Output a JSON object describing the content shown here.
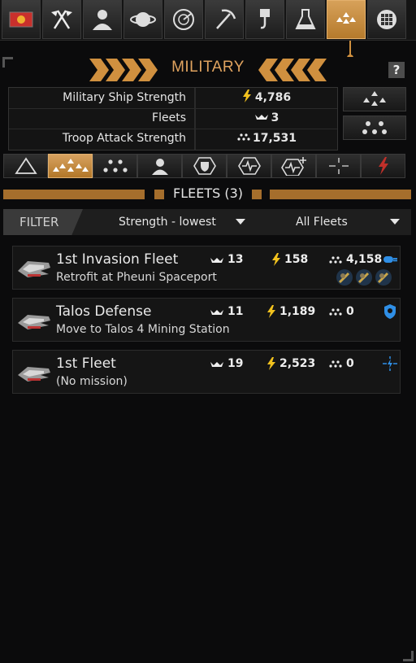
{
  "topbar": {
    "buttons": [
      {
        "icon": "empire-flag-icon",
        "active": false
      },
      {
        "icon": "diplomacy-flags-icon",
        "active": false
      },
      {
        "icon": "leader-person-icon",
        "active": false
      },
      {
        "icon": "planet-icon",
        "active": false
      },
      {
        "icon": "radar-icon",
        "active": false
      },
      {
        "icon": "mining-pickaxe-icon",
        "active": false
      },
      {
        "icon": "construction-hook-icon",
        "active": false
      },
      {
        "icon": "research-flask-icon",
        "active": false
      },
      {
        "icon": "military-fleet-icon",
        "active": true
      },
      {
        "icon": "colonies-grid-icon",
        "active": false
      }
    ]
  },
  "header": {
    "title": "MILITARY",
    "help_label": "?"
  },
  "stats": {
    "rows": [
      {
        "label": "Military Ship Strength",
        "value": "4,786",
        "icon": "lightning-icon"
      },
      {
        "label": "Fleets",
        "value": "3",
        "icon": "ships-icon"
      },
      {
        "label": "Troop Attack Strength",
        "value": "17,531",
        "icon": "troops-icon"
      }
    ]
  },
  "tabs": [
    {
      "icon": "triangle-outline-icon",
      "active": false
    },
    {
      "icon": "fleets-tab-icon",
      "active": true
    },
    {
      "icon": "troops-dots-icon",
      "active": false
    },
    {
      "icon": "person-icon",
      "active": false
    },
    {
      "icon": "shield-hex-icon",
      "active": false
    },
    {
      "icon": "pulse-hex-icon",
      "active": false
    },
    {
      "icon": "pulse-plus-icon",
      "active": false
    },
    {
      "icon": "crosshair-icon",
      "active": false
    },
    {
      "icon": "lightning-red-icon",
      "active": false
    }
  ],
  "fleets_header": {
    "title": "FLEETS (3)"
  },
  "filter": {
    "label": "FILTER",
    "sort_value": "Strength - lowest",
    "fleet_filter_value": "All Fleets"
  },
  "fleets": [
    {
      "name": "1st Invasion Fleet",
      "mission": "Retrofit at Pheuni Spaceport",
      "ships": "13",
      "strength": "158",
      "troops": "4,158",
      "status": "retrofit-icon",
      "status_color": "#2f8fe6",
      "has_troops": true
    },
    {
      "name": "Talos Defense",
      "mission": "Move to Talos 4 Mining Station",
      "ships": "11",
      "strength": "1,189",
      "troops": "0",
      "status": "location-pin-icon",
      "status_color": "#2f8fe6",
      "has_troops": false
    },
    {
      "name": "1st Fleet",
      "mission": "(No mission)",
      "ships": "19",
      "strength": "2,523",
      "troops": "0",
      "status": "crosshair-lightning-icon",
      "status_color": "#2f8fe6",
      "has_troops": false
    }
  ],
  "colors": {
    "accent": "#d0903f",
    "lightning": "#f2c21e",
    "status_blue": "#2f8fe6"
  }
}
